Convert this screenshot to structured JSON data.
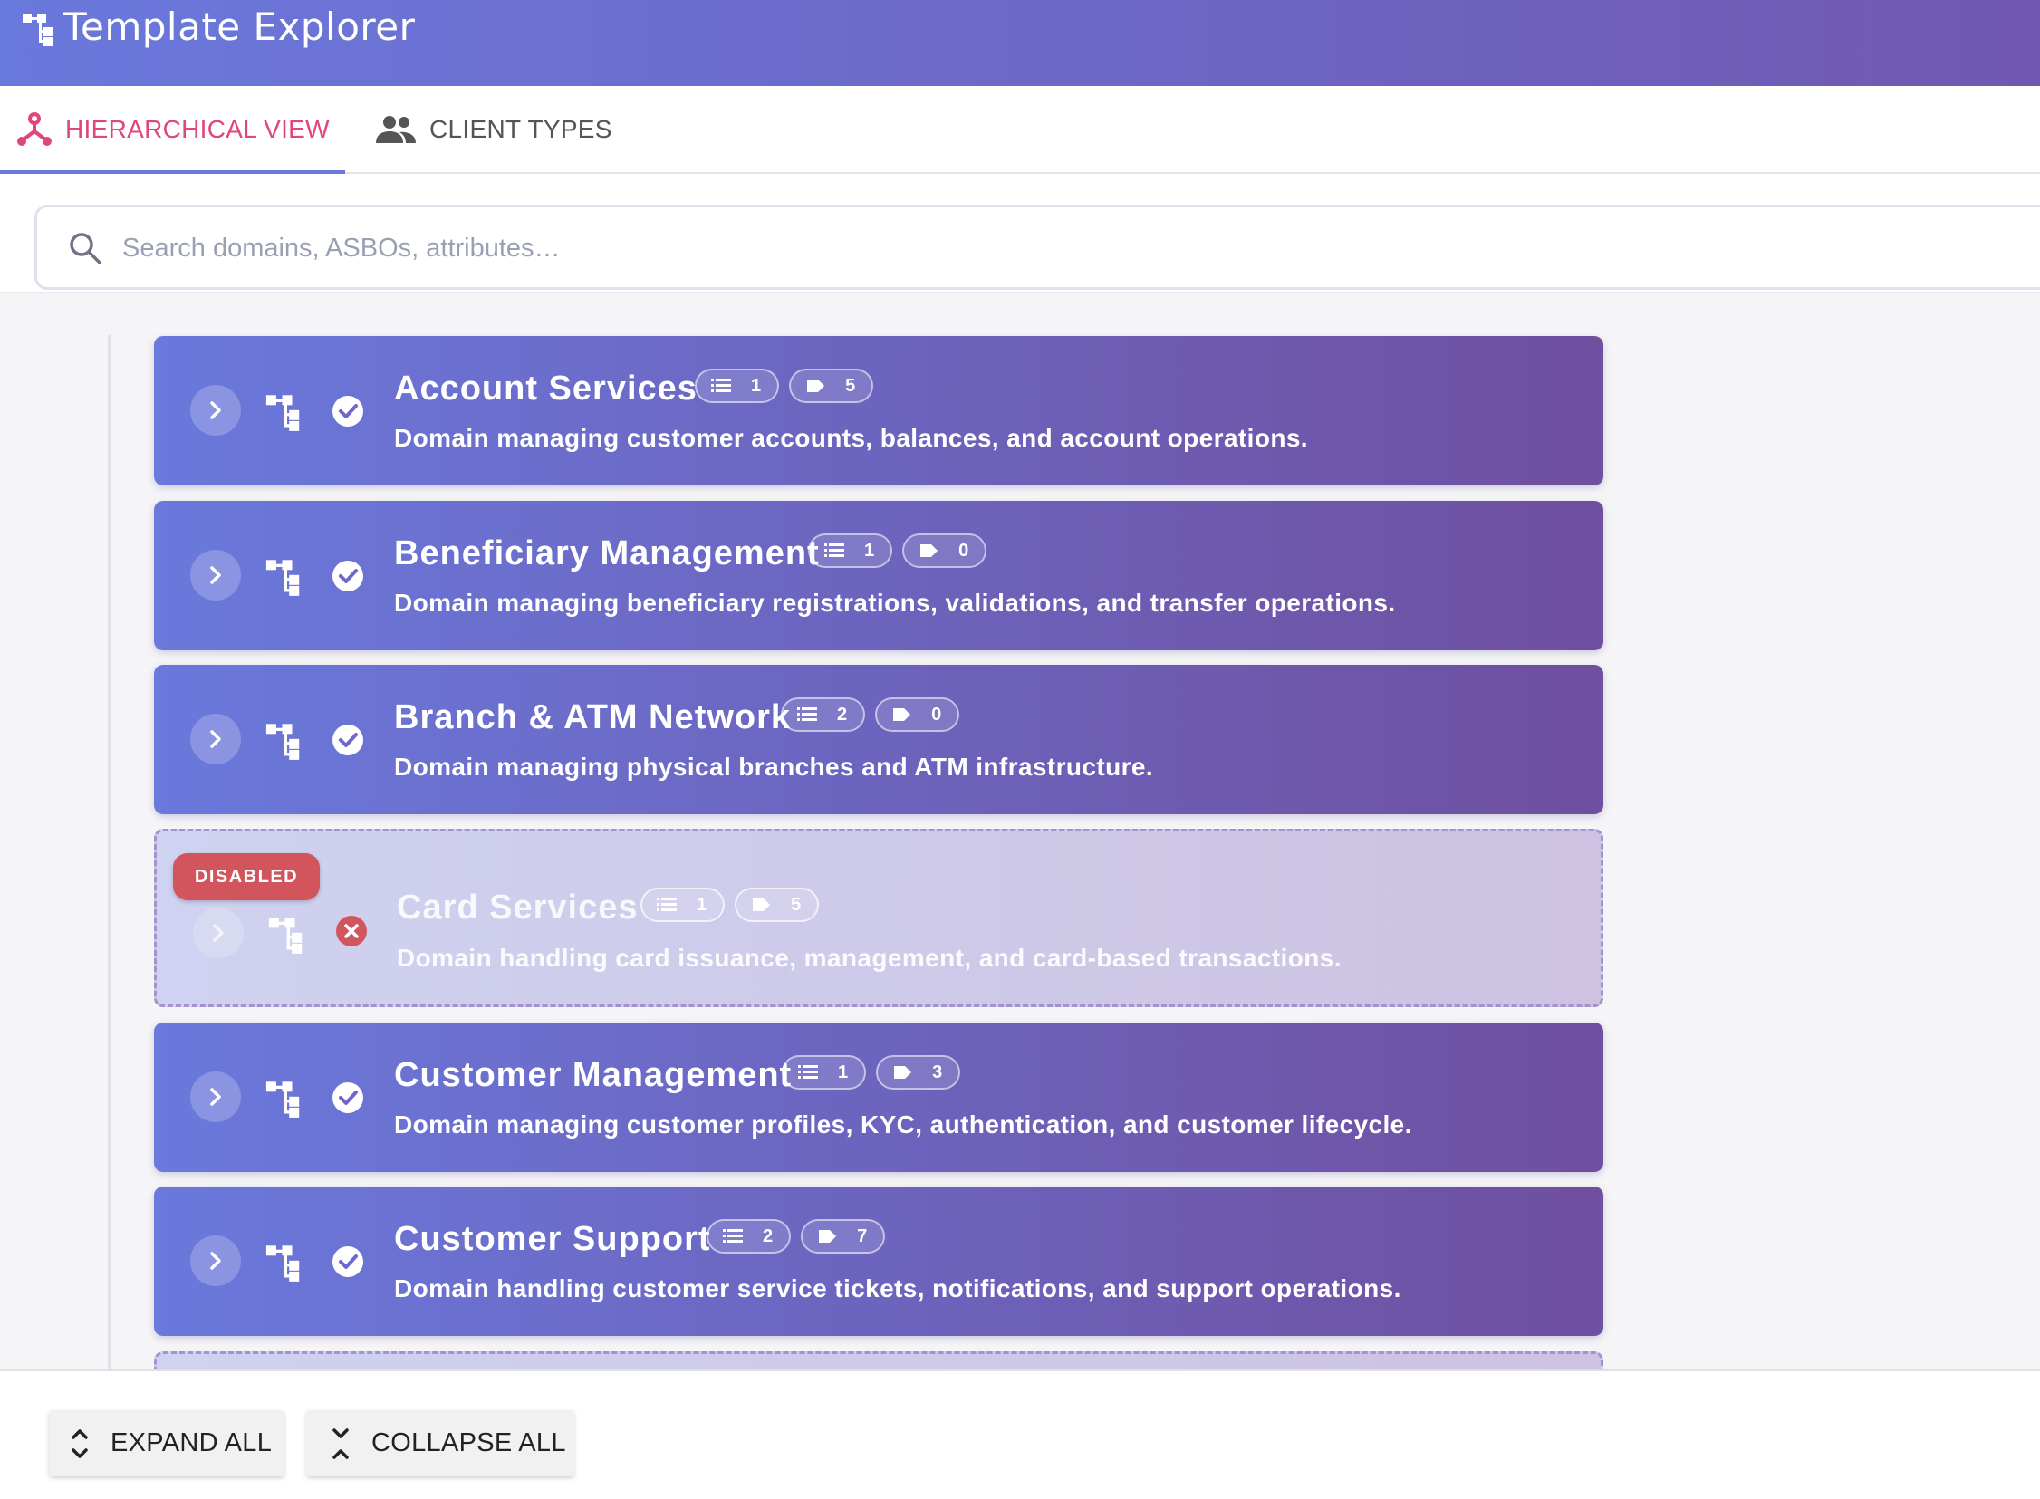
{
  "app": {
    "title": "Template Explorer"
  },
  "tabs": [
    {
      "label": "HIERARCHICAL VIEW",
      "icon": "hierarchy-icon",
      "active": true
    },
    {
      "label": "CLIENT TYPES",
      "icon": "people-icon",
      "active": false
    }
  ],
  "search": {
    "placeholder": "Search domains, ASBOs, attributes…",
    "value": ""
  },
  "domains": [
    {
      "name": "Account Services",
      "list_count": "1",
      "tag_count": "5",
      "description": "Domain managing customer accounts, balances, and account operations.",
      "status": "enabled"
    },
    {
      "name": "Beneficiary Management",
      "list_count": "1",
      "tag_count": "0",
      "description": "Domain managing beneficiary registrations, validations, and transfer operations.",
      "status": "enabled"
    },
    {
      "name": "Branch & ATM Network",
      "list_count": "2",
      "tag_count": "0",
      "description": "Domain managing physical branches and ATM infrastructure.",
      "status": "enabled"
    },
    {
      "name": "Card Services",
      "list_count": "1",
      "tag_count": "5",
      "description": "Domain handling card issuance, management, and card-based transactions.",
      "status": "disabled",
      "badge": "DISABLED"
    },
    {
      "name": "Customer Management",
      "list_count": "1",
      "tag_count": "3",
      "description": "Domain managing customer profiles, KYC, authentication, and customer lifecycle.",
      "status": "enabled"
    },
    {
      "name": "Customer Support",
      "list_count": "2",
      "tag_count": "7",
      "description": "Domain handling customer service tickets, notifications, and support operations.",
      "status": "enabled"
    }
  ],
  "footer": {
    "expand_all": "EXPAND ALL",
    "collapse_all": "COLLAPSE ALL"
  },
  "colors": {
    "accent": "#e0457b",
    "primary": "#6a79dc",
    "header_end": "#7058b2",
    "disabled_badge": "#d2555e"
  }
}
